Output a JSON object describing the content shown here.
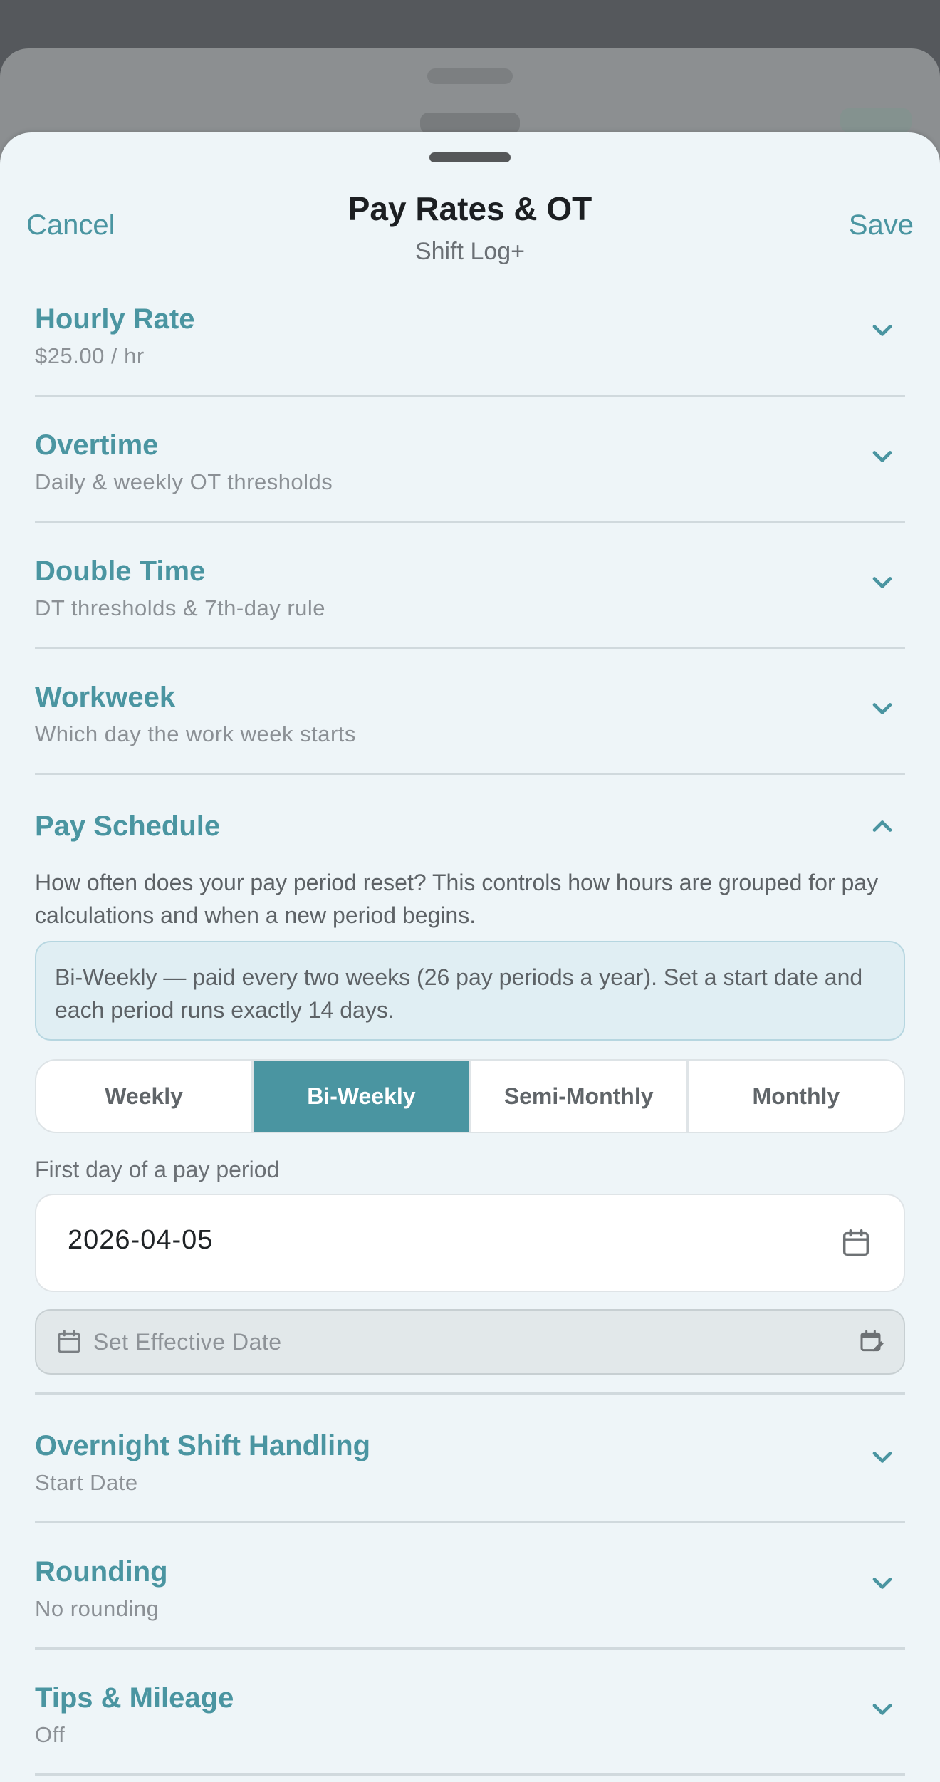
{
  "header": {
    "cancel_label": "Cancel",
    "title": "Pay Rates & OT",
    "subtitle": "Shift Log+",
    "save_label": "Save"
  },
  "sections": [
    {
      "title": "Hourly Rate",
      "subtitle": "$25.00 / hr",
      "expanded": false
    },
    {
      "title": "Overtime",
      "subtitle": "Daily & weekly OT thresholds",
      "expanded": false
    },
    {
      "title": "Double Time",
      "subtitle": "DT thresholds & 7th-day rule",
      "expanded": false
    },
    {
      "title": "Workweek",
      "subtitle": "Which day the work week starts",
      "expanded": false
    }
  ],
  "pay_schedule": {
    "title": "Pay Schedule",
    "expanded": true,
    "description": "How often does your pay period reset? This controls how hours are grouped for pay calculations and when a new period begins.",
    "info": "Bi-Weekly — paid every two weeks (26 pay periods a year). Set a start date and each period runs exactly 14 days.",
    "options": [
      "Weekly",
      "Bi-Weekly",
      "Semi-Monthly",
      "Monthly"
    ],
    "selected": "Bi-Weekly",
    "first_day_label": "First day of a pay period",
    "first_day_value": "2026-04-05",
    "effective_date_placeholder": "Set Effective Date"
  },
  "sections_after": [
    {
      "title": "Overnight Shift Handling",
      "subtitle": "Start Date",
      "expanded": false
    },
    {
      "title": "Rounding",
      "subtitle": "No rounding",
      "expanded": false
    },
    {
      "title": "Tips & Mileage",
      "subtitle": "Off",
      "expanded": false
    }
  ],
  "colors": {
    "accent": "#4a95a1",
    "sheet_background": "#eef5f8",
    "info_background": "#e0eef3"
  },
  "icons": {
    "collapsed": "chevron-down-icon",
    "expanded": "chevron-up-icon",
    "date": "calendar-icon",
    "effective_date": "calendar-edit-icon"
  }
}
